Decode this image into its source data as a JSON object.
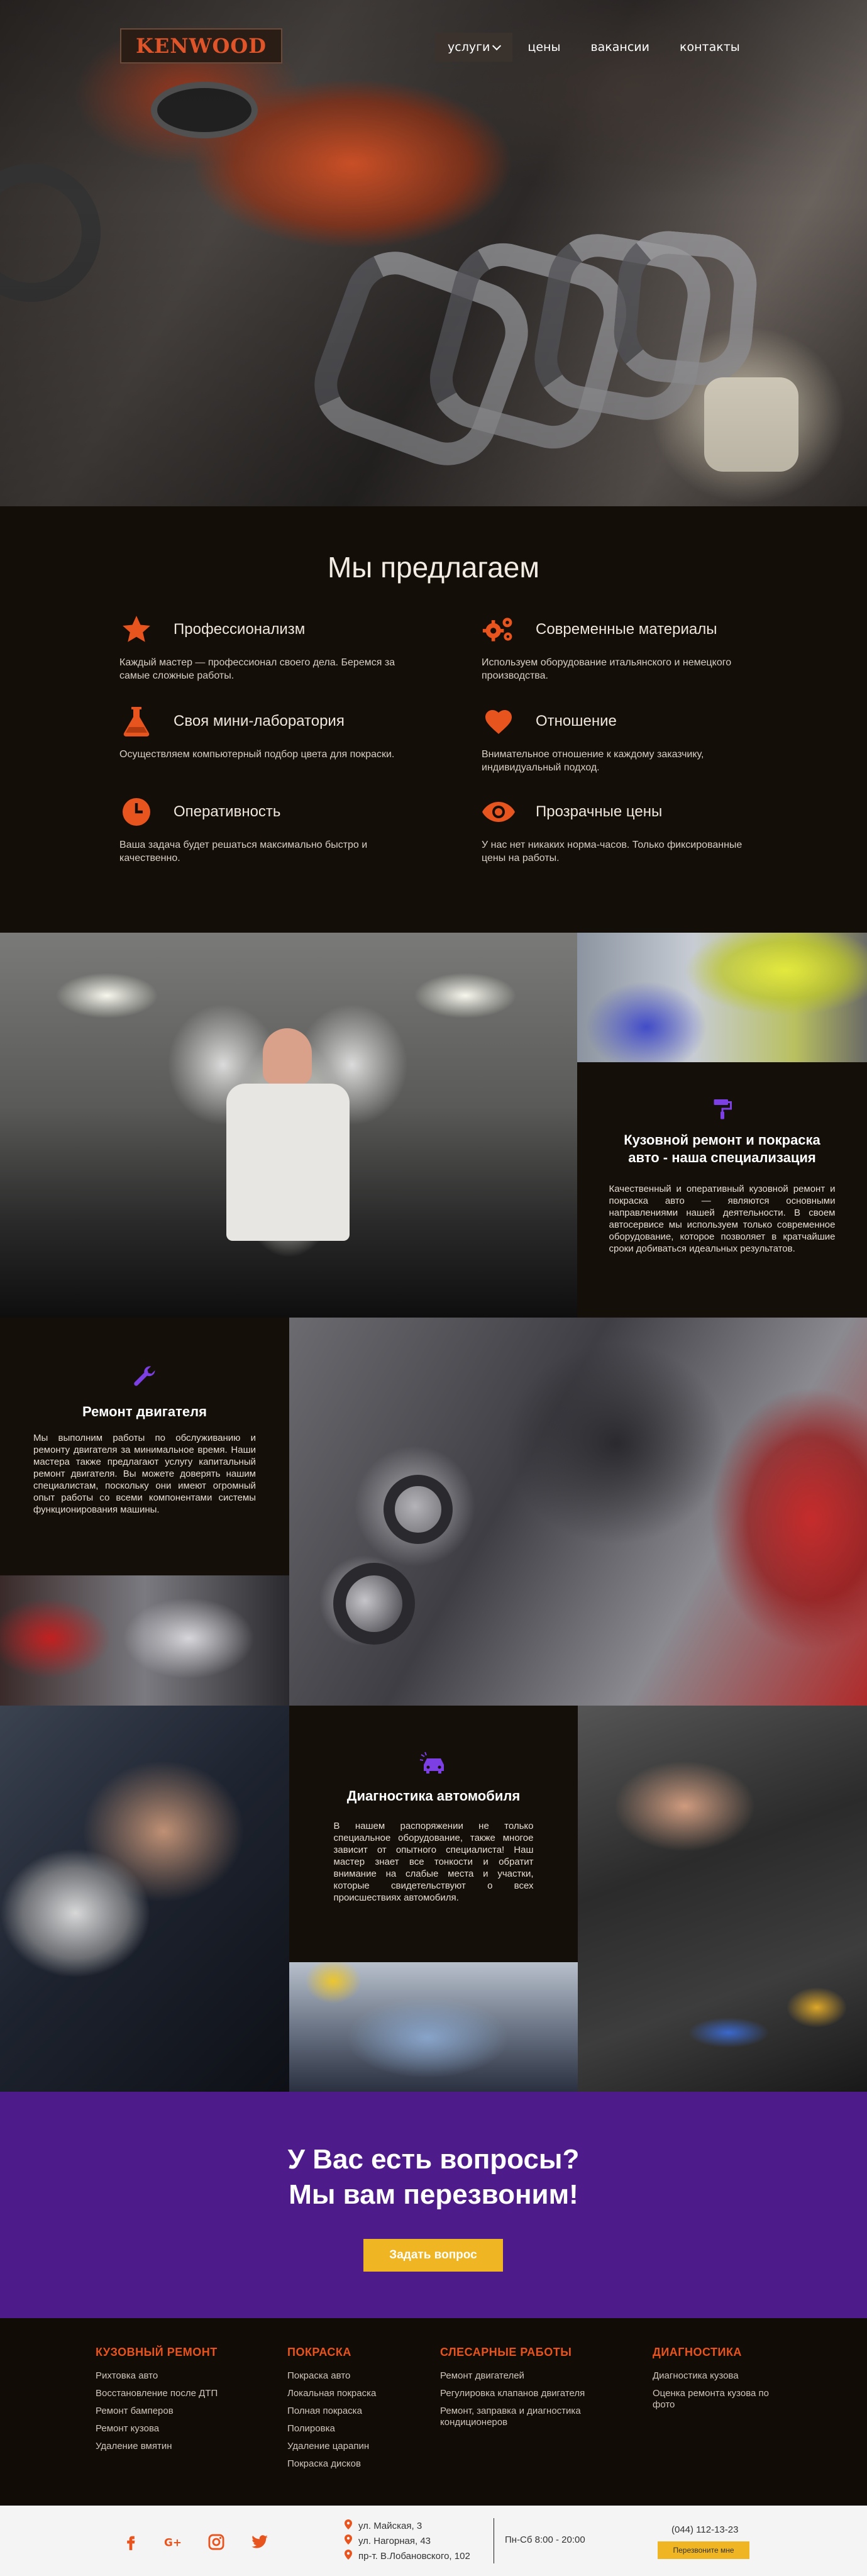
{
  "header": {
    "logo": "KENWOOD",
    "nav": [
      {
        "label": "услуги"
      },
      {
        "label": "цены"
      },
      {
        "label": "вакансии"
      },
      {
        "label": "контакты"
      }
    ]
  },
  "offer": {
    "title": "Мы предлагаем",
    "features": [
      {
        "icon": "star-icon",
        "title": "Профессионализм",
        "desc": "Каждый мастер — профессионал своего дела. Беремся за самые сложные работы."
      },
      {
        "icon": "gears-icon",
        "title": "Современные материалы",
        "desc": "Используем оборудование итальянского и немецкого производства."
      },
      {
        "icon": "flask-icon",
        "title": "Своя мини-лаборатория",
        "desc": "Осуществляем компьютерный подбор цвета для покраски."
      },
      {
        "icon": "heart-icon",
        "title": "Отношение",
        "desc": "Внимательное отношение к каждому заказчику, индивидуальный подход."
      },
      {
        "icon": "clock-icon",
        "title": "Оперативность",
        "desc": "Ваша задача будет решаться максимально быстро и качественно."
      },
      {
        "icon": "eye-icon",
        "title": "Прозрачные цены",
        "desc": "У нас нет никаких норма-часов. Только фиксированные цены на работы."
      }
    ]
  },
  "services": [
    {
      "icon": "paint-roller-icon",
      "title": "Кузовной ремонт и покраска авто - наша специализация",
      "desc": "Качественный и оперативный кузовной ремонт и покраска авто — являются основными направлениями нашей деятельности. В своем автосервисе мы используем только современное оборудование, которое позволяет в кратчайшие сроки добиваться идеальных результатов."
    },
    {
      "icon": "wrench-icon",
      "title": "Ремонт двигателя",
      "desc": "Мы выполним работы по обслуживанию и ремонту двигателя за минимальное время. Наши мастера также предлагают услугу капитальный ремонт двигателя. Вы можете доверять нашим специалистам, поскольку они имеют огромный опыт работы со всеми компонентами системы функционирования машины."
    },
    {
      "icon": "car-diagnostics-icon",
      "title": "Диагностика автомобиля",
      "desc": "В нашем распоряжении не только специальное оборудование, также многое зависит от опытного специалиста! Наш мастер знает все тонкости и обратит внимание на слабые места и участки, которые свидетельствуют о всех происшествиях автомобиля."
    }
  ],
  "callback": {
    "title_line1": "У Вас есть вопросы?",
    "title_line2": "Мы вам перезвоним!",
    "button": "Задать вопрос"
  },
  "footer_links": [
    {
      "heading": "КУЗОВНЫЙ РЕМОНТ",
      "links": [
        "Рихтовка авто",
        "Восстановление после ДТП",
        "Ремонт бамперов",
        "Ремонт кузова",
        "Удаление вмятин"
      ]
    },
    {
      "heading": "ПОКРАСКА",
      "links": [
        "Покраска авто",
        "Локальная покраска",
        "Полная покраска",
        "Полировка",
        "Удаление царапин",
        "Покраска дисков"
      ]
    },
    {
      "heading": "СЛЕСАРНЫЕ РАБОТЫ",
      "links": [
        "Ремонт двигателей",
        "Регулировка клапанов двигателя",
        "Ремонт, заправка и диагностика кондиционеров"
      ]
    },
    {
      "heading": "ДИАГНОСТИКА",
      "links": [
        "Диагностика кузова",
        "Оценка ремонта кузова по фото"
      ]
    }
  ],
  "contacts": {
    "social": [
      "facebook-icon",
      "google-plus-icon",
      "instagram-icon",
      "twitter-icon"
    ],
    "addresses": [
      "ул. Майская, 3",
      "ул. Нагорная, 43",
      "пр-т. В.Лобановского, 102"
    ],
    "hours": "Пн-Сб 8:00 - 20:00",
    "phone": "(044) 112-13-23",
    "callback_button": "Перезвоните мне"
  },
  "colors": {
    "accent_orange": "#e8541e",
    "purple": "#4e1b8a",
    "yellow": "#f0b522",
    "dark": "#130e08",
    "violet_icon": "#7b3fe4"
  }
}
